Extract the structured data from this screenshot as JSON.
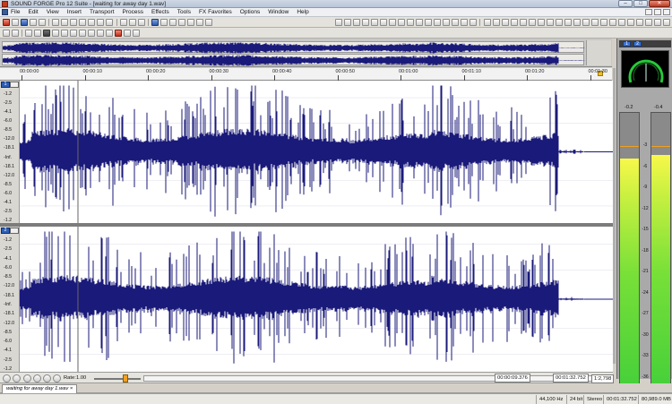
{
  "app": {
    "title": "SOUND FORGE Pro 12 Suite - [waiting for away day 1.wav]"
  },
  "window_buttons": {
    "minimize": "–",
    "maximize": "□",
    "close": "✕"
  },
  "menu": [
    "File",
    "Edit",
    "View",
    "Insert",
    "Transport",
    "Process",
    "Effects",
    "Tools",
    "FX Favorites",
    "Options",
    "Window",
    "Help"
  ],
  "ruler": {
    "labels": [
      "00:00:00",
      "00:00:10",
      "00:00:20",
      "00:00:30",
      "00:00:40",
      "00:00:50",
      "00:01:00",
      "00:01:10",
      "00:01:20",
      "00:01:30"
    ]
  },
  "channels": [
    {
      "badge": "1",
      "ylabels": [
        "-1.2",
        "-2.5",
        "-4.1",
        "-6.0",
        "-8.5",
        "-12.0",
        "-18.1",
        "-Inf.",
        "-18.1",
        "-12.0",
        "-8.5",
        "-6.0",
        "-4.1",
        "-2.5",
        "-1.2"
      ]
    },
    {
      "badge": "2",
      "ylabels": [
        "-1.2",
        "-2.5",
        "-4.1",
        "-6.0",
        "-8.5",
        "-12.0",
        "-18.1",
        "-Inf.",
        "-18.1",
        "-12.0",
        "-8.5",
        "-6.0",
        "-4.1",
        "-2.5",
        "-1.2"
      ]
    }
  ],
  "meters": {
    "ch_buttons": [
      "1",
      "2"
    ],
    "peaks": [
      "-0.2",
      "-0.4"
    ],
    "scale": [
      "-3",
      "-6",
      "-9",
      "-12",
      "-15",
      "-18",
      "-21",
      "-24",
      "-27",
      "-30",
      "-33",
      "-36",
      "-39"
    ],
    "level_left": 0.85,
    "level_right": 0.86
  },
  "transport": {
    "rate_label": "Rate:",
    "rate_value": "1.00",
    "position": "00:00:09.376",
    "length": "00:01:32.752",
    "zoom": "1:2,798"
  },
  "tabs": [
    "waiting for away day 1.wav ×"
  ],
  "status": {
    "sample_rate": "44,100 Hz",
    "bit_depth": "24 bit",
    "channels": "Stereo",
    "duration": "00:01:32.752",
    "free_space": "80,989.0 MB"
  },
  "colors": {
    "waveform": "#1a1a7a",
    "waveform_bg": "#ffffff",
    "meter_fill": "#3acc3a",
    "phase_scope": "#27c93a"
  }
}
